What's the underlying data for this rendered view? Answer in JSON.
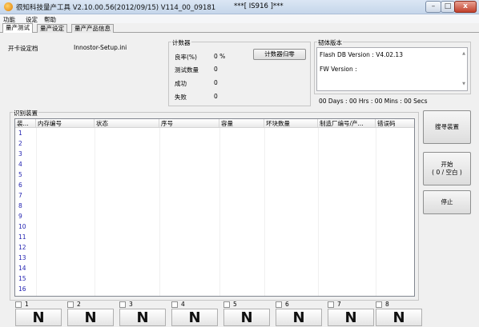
{
  "window": {
    "title": "很知科技量产工具 V2.10.00.56(2012/09/15)   V114_00_09181",
    "title_extra": "***[ IS916 ]***",
    "min_glyph": "–",
    "max_glyph": "□",
    "close_glyph": "x"
  },
  "menu": [
    "功能",
    "设定",
    "帮助"
  ],
  "tabs": [
    "量产测试",
    "量产设定",
    "量产产品信息"
  ],
  "setup": {
    "label": "开卡设定档",
    "file": "Innostor-Setup.ini"
  },
  "counter": {
    "title": "计数器",
    "reset_label": "计数器归零",
    "rows": [
      {
        "label": "良率(%)",
        "value": "0 %"
      },
      {
        "label": "测试数量",
        "value": "0"
      },
      {
        "label": "成功",
        "value": "0"
      },
      {
        "label": "失败",
        "value": "0"
      }
    ]
  },
  "firmware": {
    "title": "韧体版本",
    "flash_db": "Flash DB Version :  V4.02.13",
    "fw_version": "FW Version :",
    "elapsed": "00 Days : 00 Hrs : 00 Mins : 00 Secs"
  },
  "devices": {
    "title": "识别装置",
    "columns": [
      "装...",
      "内存编号",
      "状态",
      "序号",
      "容量",
      "坏块数量",
      "制造厂编号/产...",
      "错误码"
    ],
    "rows": [
      "1",
      "2",
      "3",
      "4",
      "5",
      "6",
      "7",
      "8",
      "9",
      "10",
      "11",
      "12",
      "13",
      "14",
      "15",
      "16"
    ]
  },
  "actions": {
    "detect_label": "搜寻装置",
    "start_label": "开始",
    "start_sub": "( 0 / 空白 )",
    "stop_label": "停止"
  },
  "slots": [
    {
      "num": "1",
      "status": "N"
    },
    {
      "num": "2",
      "status": "N"
    },
    {
      "num": "3",
      "status": "N"
    },
    {
      "num": "4",
      "status": "N"
    },
    {
      "num": "5",
      "status": "N"
    },
    {
      "num": "6",
      "status": "N"
    },
    {
      "num": "7",
      "status": "N"
    },
    {
      "num": "8",
      "status": "N"
    }
  ]
}
